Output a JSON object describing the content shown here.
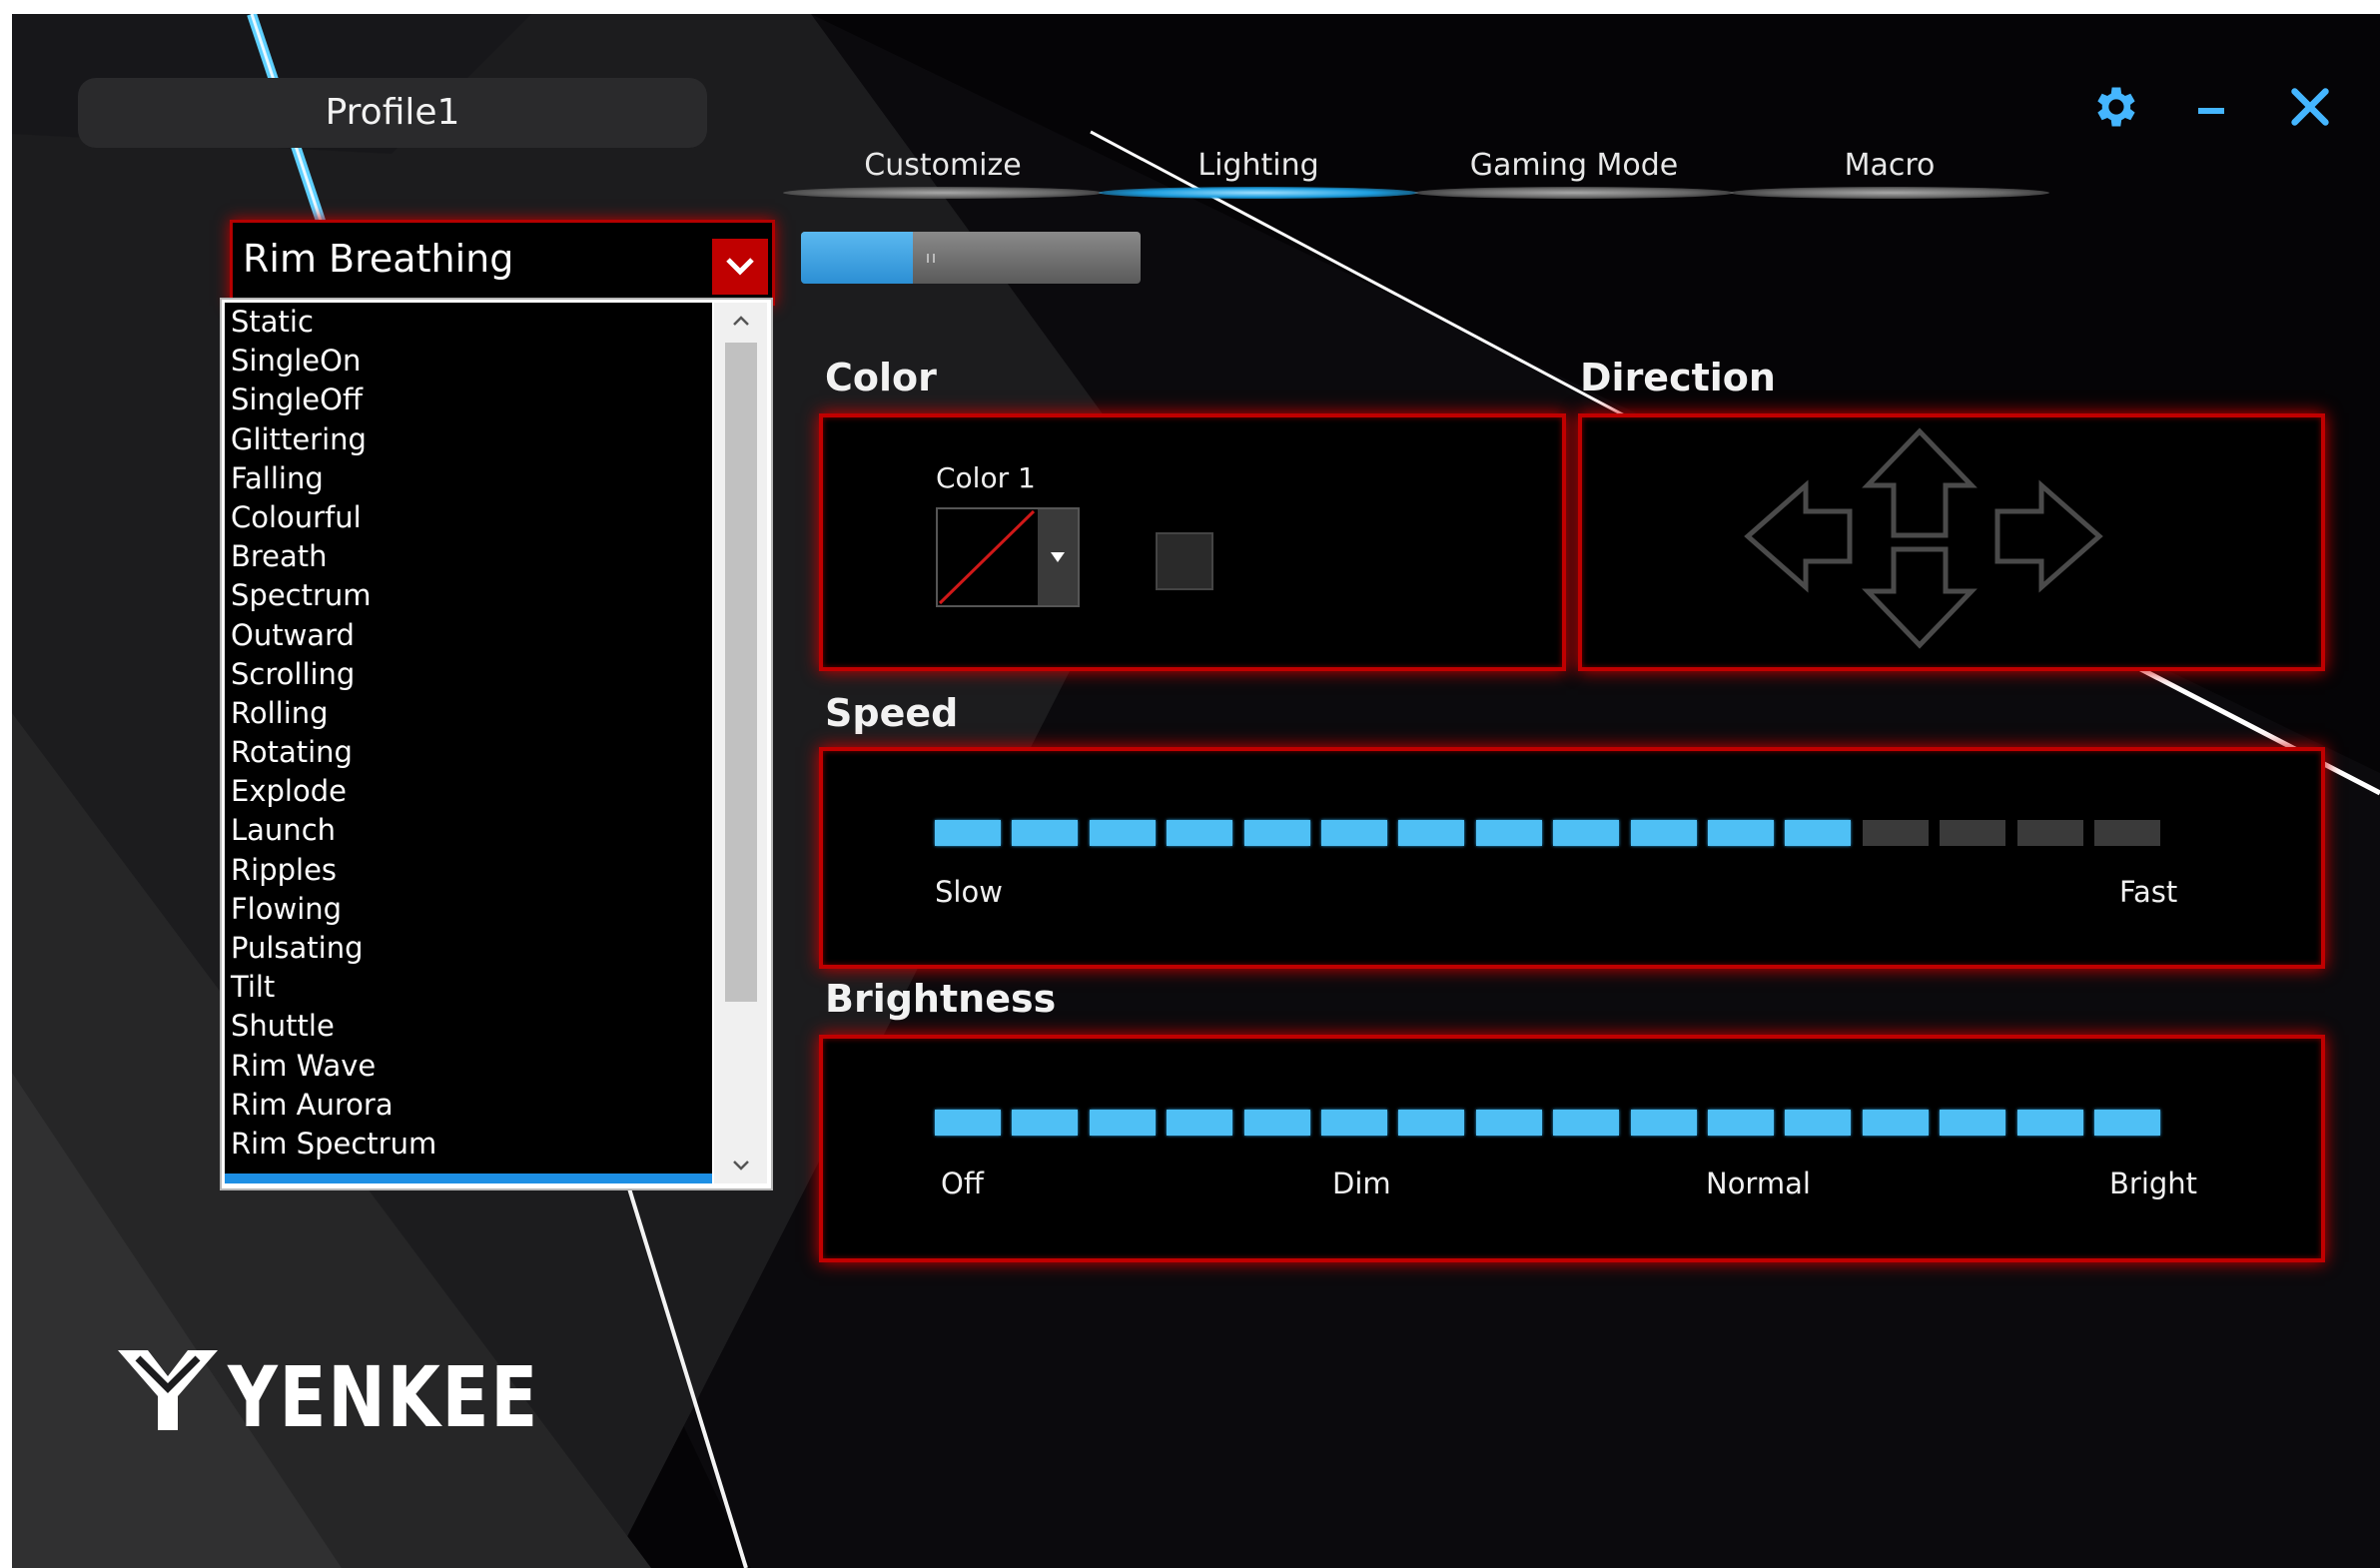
{
  "profile": {
    "name": "Profile1"
  },
  "window_controls": {
    "settings_icon": "gear-icon",
    "minimize_icon": "minimize-icon",
    "close_icon": "close-icon"
  },
  "tabs": [
    {
      "label": "Customize",
      "active": false
    },
    {
      "label": "Lighting",
      "active": true
    },
    {
      "label": "Gaming Mode",
      "active": false
    },
    {
      "label": "Macro",
      "active": false
    }
  ],
  "effect": {
    "selected": "Rim Breathing",
    "options": [
      "Static",
      "SingleOn",
      "SingleOff",
      "Glittering",
      "Falling",
      "Colourful",
      "Breath",
      "Spectrum",
      "Outward",
      "Scrolling",
      "Rolling",
      "Rotating",
      "Explode",
      "Launch",
      "Ripples",
      "Flowing",
      "Pulsating",
      "Tilt",
      "Shuttle",
      "Rim Wave",
      "Rim Aurora",
      "Rim Spectrum"
    ]
  },
  "lighting_toggle": {
    "on": true,
    "fill_fraction": 0.33
  },
  "color_section": {
    "title": "Color",
    "color1_label": "Color 1"
  },
  "direction_section": {
    "title": "Direction"
  },
  "speed": {
    "title": "Speed",
    "level": 12,
    "max": 16,
    "min_label": "Slow",
    "max_label": "Fast"
  },
  "brightness": {
    "title": "Brightness",
    "level": 16,
    "max": 16,
    "labels": [
      "Off",
      "Dim",
      "Normal",
      "Bright"
    ]
  },
  "brand": {
    "name": "YENKEE"
  },
  "colors": {
    "accent_blue": "#4fc0f5",
    "border_red": "#c00000",
    "background": "#050406"
  }
}
